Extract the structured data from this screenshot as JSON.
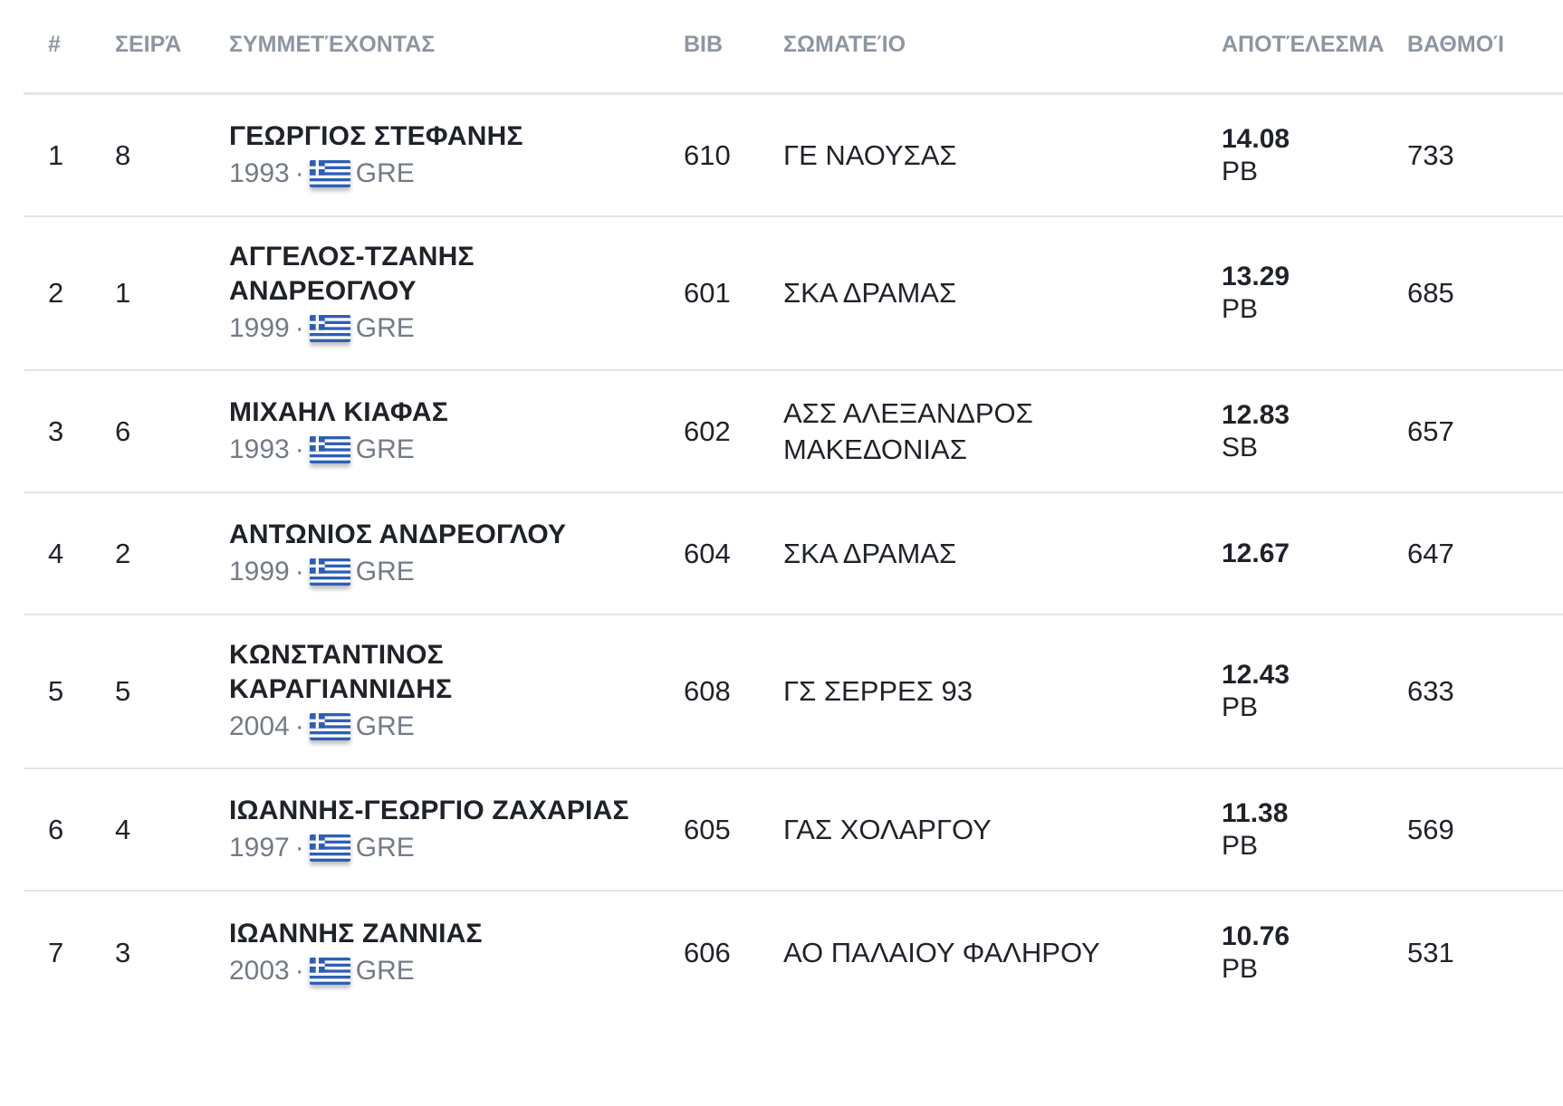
{
  "table": {
    "headers": {
      "rank": "#",
      "lane": "ΣΕΙΡΆ",
      "athlete": "ΣΥΜΜΕΤΈΧΟΝΤΑΣ",
      "bib": "BIB",
      "club": "ΣΩΜΑΤΕΊΟ",
      "result": "ΑΠΟΤΈΛΕΣΜΑ",
      "points": "ΒΑΘΜΟΊ"
    },
    "rows": [
      {
        "rank": "1",
        "lane": "8",
        "name": "ΓΕΩΡΓΙΟΣ ΣΤΕΦΑΝΗΣ",
        "year": "1993",
        "sep": "·",
        "country": "GRE",
        "bib": "610",
        "club": "ΓΕ ΝΑΟΥΣΑΣ",
        "result": "14.08",
        "note": "PB",
        "points": "733"
      },
      {
        "rank": "2",
        "lane": "1",
        "name": "ΑΓΓΕΛΟΣ-ΤΖΑΝΗΣ ΑΝΔΡΕΟΓΛΟΥ",
        "year": "1999",
        "sep": "·",
        "country": "GRE",
        "bib": "601",
        "club": "ΣΚΑ ΔΡΑΜΑΣ",
        "result": "13.29",
        "note": "PB",
        "points": "685"
      },
      {
        "rank": "3",
        "lane": "6",
        "name": "ΜΙΧΑΗΛ ΚΙΑΦΑΣ",
        "year": "1993",
        "sep": "·",
        "country": "GRE",
        "bib": "602",
        "club": "ΑΣΣ ΑΛΕΞΑΝΔΡΟΣ ΜΑΚΕΔΟΝΙΑΣ",
        "result": "12.83",
        "note": "SB",
        "points": "657"
      },
      {
        "rank": "4",
        "lane": "2",
        "name": "ΑΝΤΩΝΙΟΣ ΑΝΔΡΕΟΓΛΟΥ",
        "year": "1999",
        "sep": "·",
        "country": "GRE",
        "bib": "604",
        "club": "ΣΚΑ ΔΡΑΜΑΣ",
        "result": "12.67",
        "note": "",
        "points": "647"
      },
      {
        "rank": "5",
        "lane": "5",
        "name": "ΚΩΝΣΤΑΝΤΙΝΟΣ ΚΑΡΑΓΙΑΝΝΙΔΗΣ",
        "year": "2004",
        "sep": "·",
        "country": "GRE",
        "bib": "608",
        "club": "ΓΣ ΣΕΡΡΕΣ 93",
        "result": "12.43",
        "note": "PB",
        "points": "633"
      },
      {
        "rank": "6",
        "lane": "4",
        "name": "ΙΩΑΝΝΗΣ-ΓΕΩΡΓΙΟ ΖΑΧΑΡΙΑΣ",
        "year": "1997",
        "sep": "·",
        "country": "GRE",
        "bib": "605",
        "club": "ΓΑΣ ΧΟΛΑΡΓΟΥ",
        "result": "11.38",
        "note": "PB",
        "points": "569"
      },
      {
        "rank": "7",
        "lane": "3",
        "name": "ΙΩΑΝΝΗΣ ΖΑΝΝΙΑΣ",
        "year": "2003",
        "sep": "·",
        "country": "GRE",
        "bib": "606",
        "club": "ΑΟ ΠΑΛΑΙΟΥ ΦΑΛΗΡΟΥ",
        "result": "10.76",
        "note": "PB",
        "points": "531"
      }
    ]
  },
  "flag_icon": "greece-flag-icon",
  "colors": {
    "header_text": "#8d96a2",
    "meta_text": "#737b86",
    "divider": "#e3e5e8",
    "flag_blue": "#2e5fb5"
  }
}
